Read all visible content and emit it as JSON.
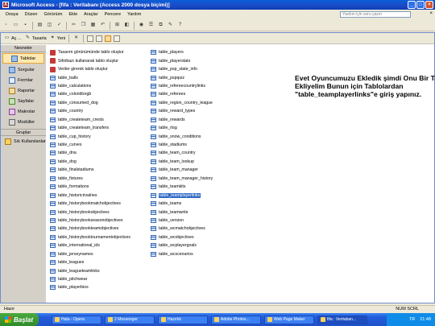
{
  "window": {
    "title": "Microsoft Access - [fifa : Veritabanı (Access 2000 dosya biçimi)]"
  },
  "menu": {
    "items": [
      "Dosya",
      "Düzen",
      "Görünüm",
      "Ekle",
      "Araçlar",
      "Pencere",
      "Yardım"
    ],
    "help_placeholder": "Yardım için soru yazın"
  },
  "db_toolbar": {
    "open": "Aç",
    "design": "Tasarla",
    "new": "Yeni"
  },
  "nav": {
    "header": "Nesneler",
    "items": [
      "Tablolar",
      "Sorgular",
      "Formlar",
      "Raporlar",
      "Sayfalar",
      "Makrolar",
      "Modüller"
    ],
    "groups_header": "Gruplar",
    "groups": [
      "Sık Kullanılanlar"
    ]
  },
  "list": {
    "col1": [
      "Tasarım görünümünde tablo oluştur",
      "Sihirbazı kullanarak tablo oluştur",
      "Veriler girerek tablo oluştur",
      "table_balls",
      "table_calculations",
      "table_coloridtorgb",
      "table_consumed_dog",
      "table_country",
      "table_createteam_crests",
      "table_createteam_transfers",
      "table_cup_history",
      "table_curves",
      "table_dna",
      "table_dog",
      "table_finalstadiums",
      "table_fixtures",
      "table_formations",
      "table_historicrivalries",
      "table_historybookmatchobjectives",
      "table_historybookobjectives",
      "table_historybookseasonobjectives",
      "table_historybookteamobjectives",
      "table_historybooktournamentobjectives",
      "table_international_ids",
      "table_jerseynames",
      "table_leagues",
      "table_leagueteamlinks",
      "table_pitchwear",
      "table_playerbios"
    ],
    "col2": [
      "table_players",
      "table_playerstats",
      "table_psp_state_info",
      "table_pspquiz",
      "table_refereecountrylinks",
      "table_referees",
      "table_region_country_league",
      "table_reward_types",
      "table_rewards",
      "table_rtsg",
      "table_snow_conditions",
      "table_stadiums",
      "table_team_country",
      "table_team_lookup",
      "table_team_manager",
      "table_team_manager_history",
      "table_teamkits",
      "table_teamplayerlinks",
      "table_teams",
      "table_teamwrite",
      "table_version",
      "table_wcmatchobjectives",
      "table_wcobjectives",
      "table_wcplayergoals",
      "table_wcscenarios"
    ],
    "selected": "table_teamplayerlinks"
  },
  "note": "Evet Oyuncumuzu Ekledik şimdi Onu Bir Takıma Ekliyelim Bunun için Tablolardan \"table_teamplayerlinks\"e giriş yapınız.",
  "status": {
    "left": "Hazır",
    "right": "NUM  SCRL"
  },
  "taskbar": {
    "start": "Başlat",
    "tasks": [
      "Hata - Opera",
      "2 Messenger",
      "Hazırlık",
      "Adobe Photos...",
      "Web Page Maker",
      "fifa : Veritaban..."
    ],
    "lang": "TR",
    "clock": "21:48"
  }
}
